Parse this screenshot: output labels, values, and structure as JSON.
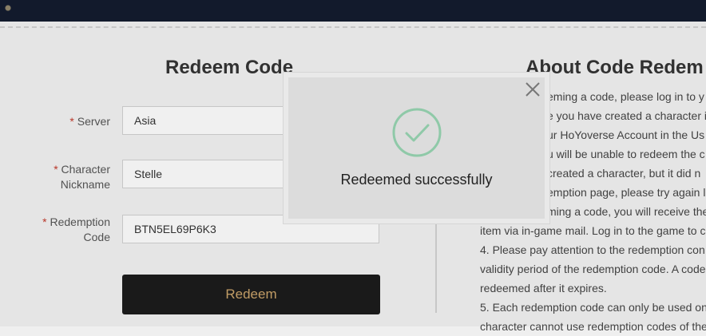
{
  "form": {
    "title": "Redeem Code",
    "required_mark": "*",
    "server_label": "Server",
    "server_value": "Asia",
    "nickname_label_line1": "Character",
    "nickname_label_line2": "Nickname",
    "nickname_value": "Stelle",
    "code_label_line1": "Redemption",
    "code_label_line2": "Code",
    "code_value": "BTN5EL69P6K3",
    "redeem_button": "Redeem"
  },
  "about": {
    "title": "About Code Redem",
    "lines": [
      "eming a code, please log in to y",
      "e you have created a character i",
      "ur HoYoverse Account in the Us",
      "u will be unable to redeem the c",
      "created a character, but it did n",
      "emption page, please try again la",
      "ming a code, you will receive the",
      "item via in-game mail. Log in to the game to c",
      "4. Please pay attention to the redemption con",
      "validity period of the redemption code. A code",
      "redeemed after it expires.",
      "5. Each redemption code can only be used on",
      "character cannot use redemption codes of the"
    ]
  },
  "modal": {
    "message": "Redeemed successfully",
    "close_icon": "close-icon",
    "status_icon": "check-circle-icon",
    "accent_color": "#8fc9a8"
  }
}
